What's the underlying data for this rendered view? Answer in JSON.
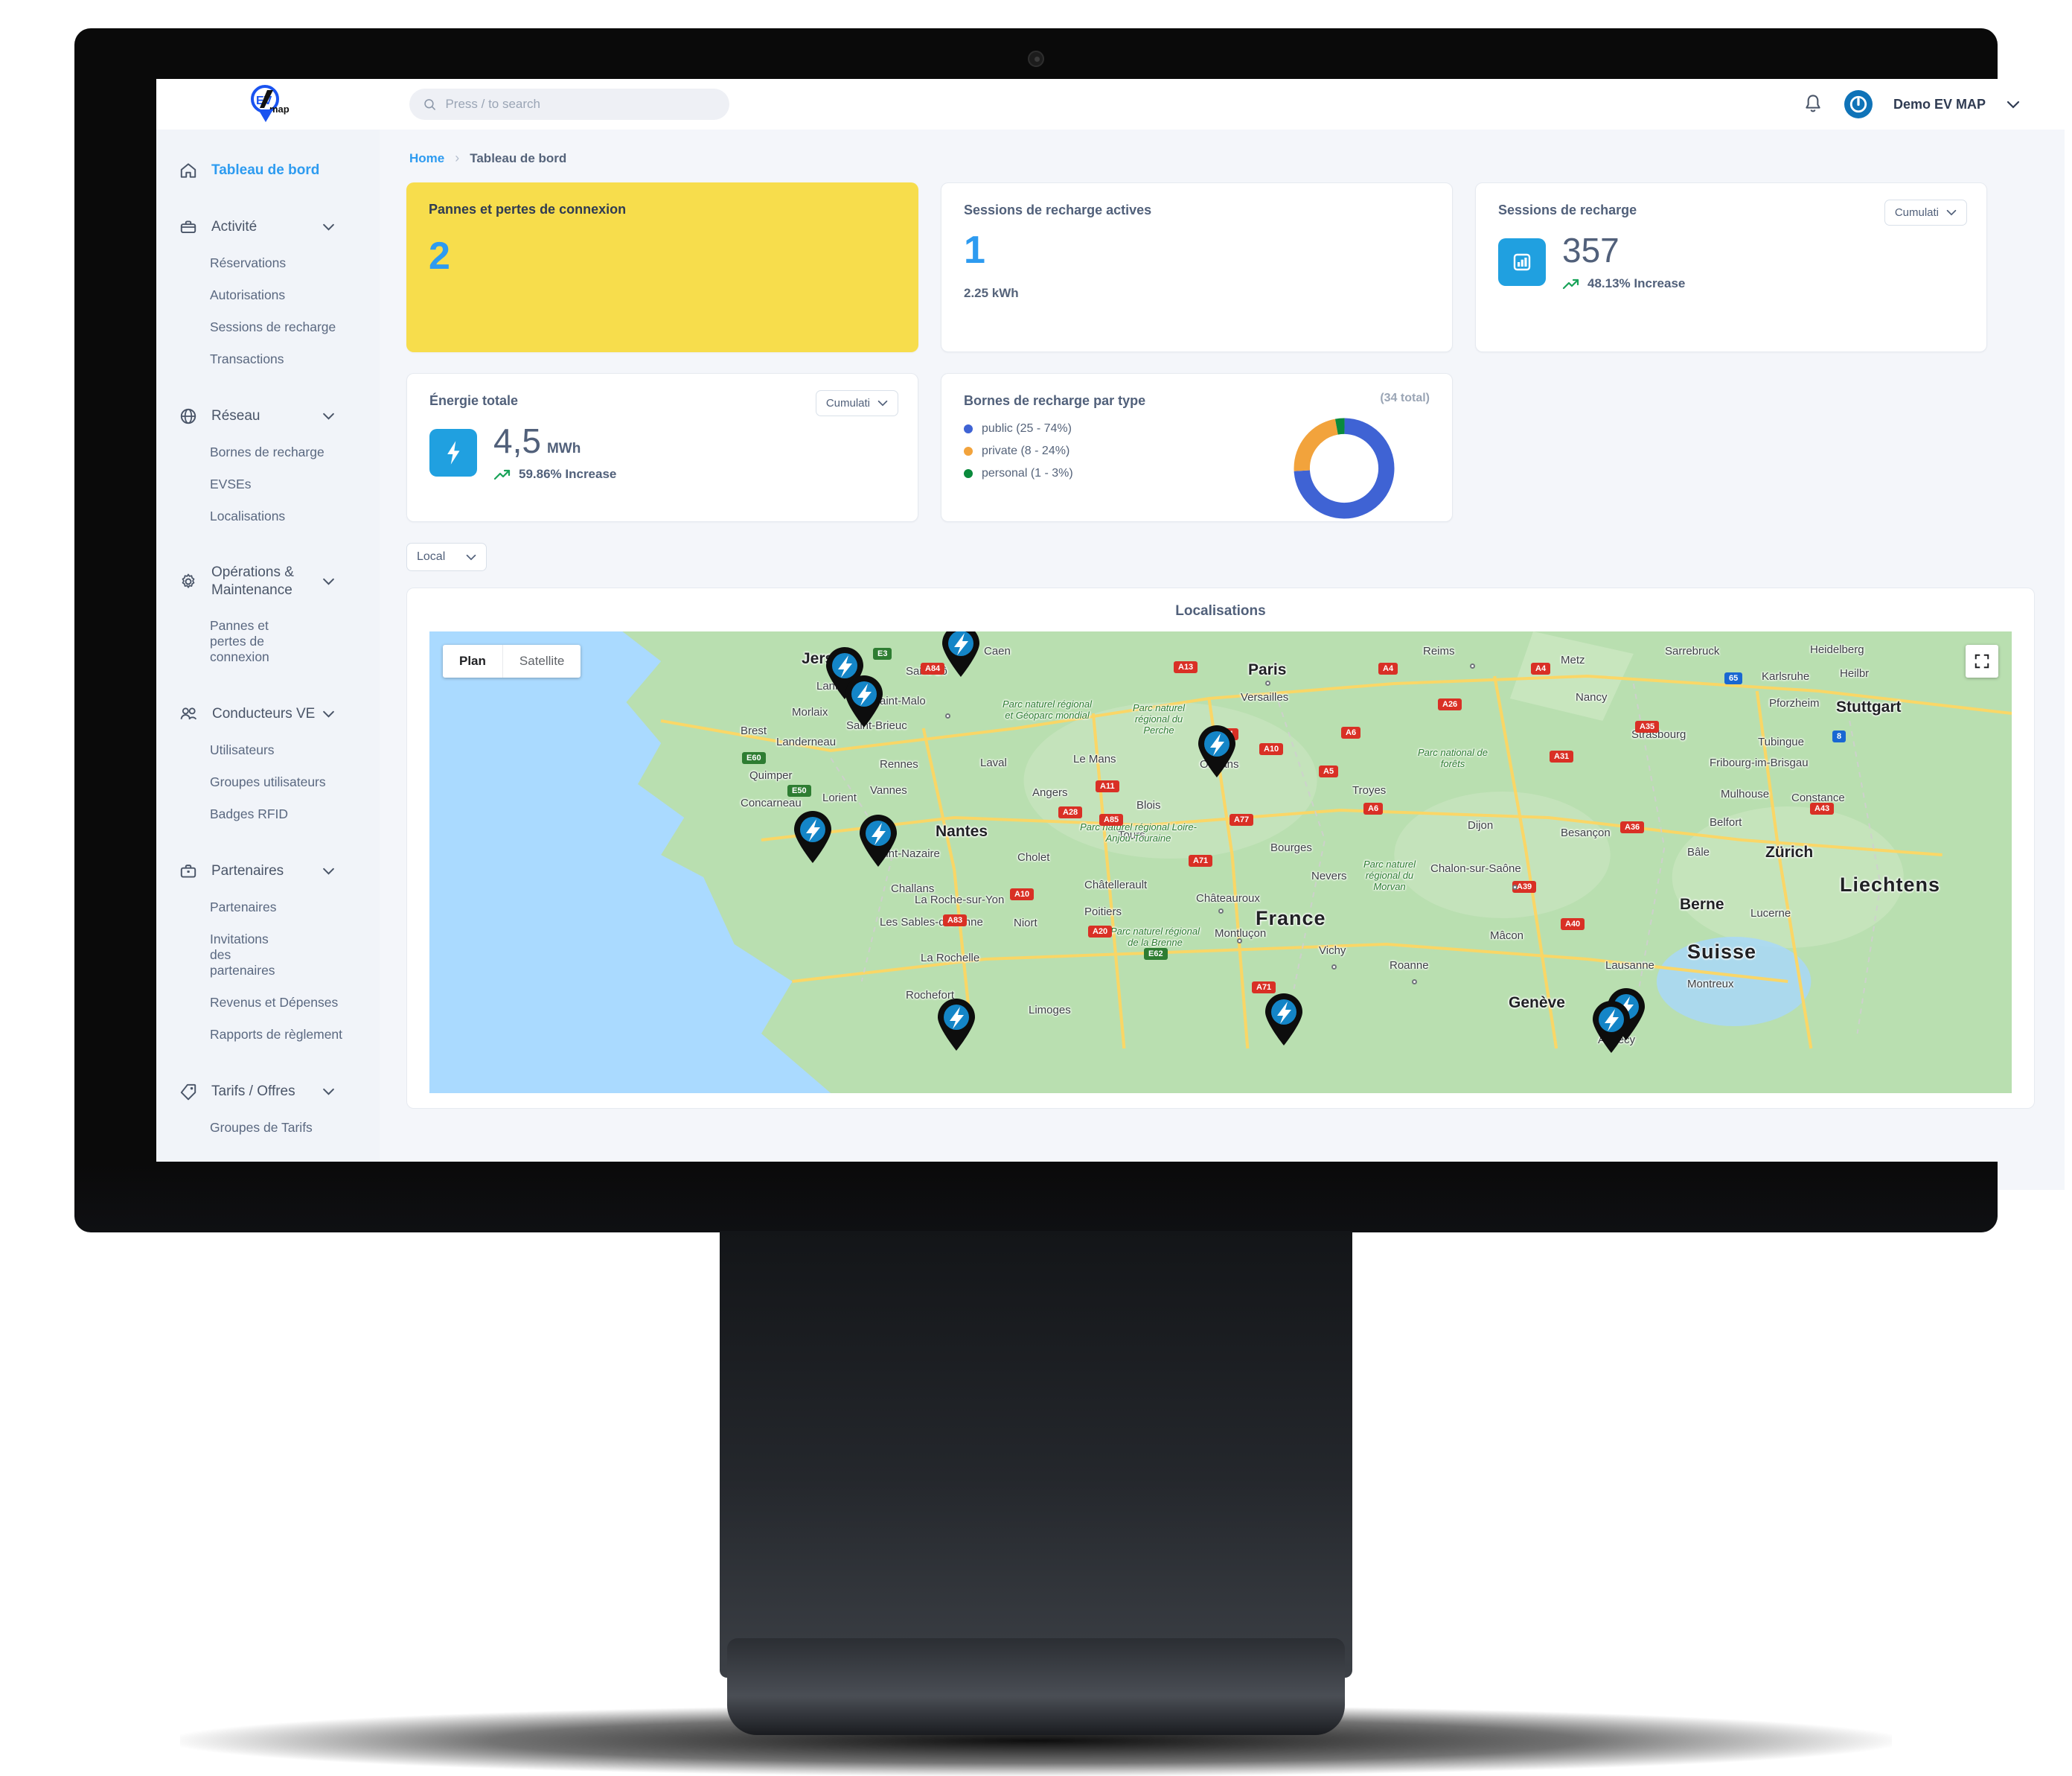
{
  "header": {
    "logo_text_main": "EV",
    "logo_text_sub": "map",
    "search_placeholder": "Press / to search",
    "search_value": "",
    "account_name": "Demo EV MAP"
  },
  "breadcrumb": {
    "home": "Home",
    "separator": "›",
    "current": "Tableau de bord"
  },
  "sidebar": {
    "dashboard": "Tableau de bord",
    "groups": [
      {
        "label": "Activité",
        "icon": "briefcase-icon",
        "items": [
          "Réservations",
          "Autorisations",
          "Sessions de recharge",
          "Transactions"
        ]
      },
      {
        "label": "Réseau",
        "icon": "globe-icon",
        "items": [
          "Bornes de recharge",
          "EVSEs",
          "Localisations"
        ]
      },
      {
        "label": "Opérations & Maintenance",
        "icon": "gear-icon",
        "items": [
          "Pannes et pertes de connexion"
        ]
      },
      {
        "label": "Conducteurs VE",
        "icon": "users-icon",
        "items": [
          "Utilisateurs",
          "Groupes utilisateurs",
          "Badges RFID"
        ]
      },
      {
        "label": "Partenaires",
        "icon": "briefcase-icon",
        "items": [
          "Partenaires",
          "Invitations des partenaires",
          "Revenus et Dépenses",
          "Rapports de règlement"
        ]
      },
      {
        "label": "Tarifs / Offres",
        "icon": "tag-icon",
        "items": [
          "Groupes de Tarifs"
        ]
      }
    ]
  },
  "cards": {
    "alerts": {
      "title": "Pannes et pertes de connexion",
      "value": "2"
    },
    "active_sessions": {
      "title": "Sessions de recharge actives",
      "value": "1",
      "subtitle": "2.25 kWh"
    },
    "sessions": {
      "title": "Sessions de recharge",
      "select": "Cumulati",
      "value": "357",
      "trend": "48.13% Increase",
      "icon": "bar-chart-icon"
    },
    "energy": {
      "title": "Énergie totale",
      "select": "Cumulati",
      "value": "4,5",
      "unit": "MWh",
      "trend": "59.86% Increase",
      "icon": "lightning-icon"
    },
    "types": {
      "title": "Bornes de recharge par type",
      "total": "(34 total)"
    }
  },
  "chart_data": {
    "type": "pie",
    "title": "Bornes de recharge par type",
    "total": 34,
    "total_label": "(34 total)",
    "categories": [
      "public",
      "private",
      "personal"
    ],
    "values": [
      25,
      8,
      1
    ],
    "percentages": [
      74,
      24,
      3
    ],
    "colors": [
      "#3f63d4",
      "#f2a33c",
      "#0a8a3c"
    ],
    "legend": [
      "public (25 - 74%)",
      "private (8 - 24%)",
      "personal (1 - 3%)"
    ],
    "legend_position": "left",
    "donut": true
  },
  "map_section": {
    "scope_select": "Local",
    "card_title": "Localisations",
    "toggle": {
      "plan": "Plan",
      "satellite": "Satellite",
      "selected": "Plan"
    },
    "fullscreen_icon": "fullscreen-icon",
    "marker_count": 10,
    "labels": {
      "countries": [
        "France",
        "Suisse",
        "Liechtens"
      ],
      "cities_big": [
        "Jersey",
        "Paris",
        "Stuttgart",
        "Zürich",
        "Berne",
        "Genève",
        "Nantes",
        "Dijon"
      ],
      "cities": [
        "Lannion",
        "Morlaix",
        "Saint-Brieuc",
        "Saint-Malo",
        "Caen",
        "Saint-Lô",
        "Brest",
        "Landerneau",
        "Rennes",
        "Laval",
        "Le Mans",
        "Orléans",
        "Quimper",
        "Concarneau",
        "Lorient",
        "Vannes",
        "Angers",
        "Tours",
        "Saint-Nazaire",
        "Cholet",
        "Blois",
        "Bourges",
        "Nevers",
        "Troyes",
        "Challans",
        "Châtellerault",
        "Poitiers",
        "Châteauroux",
        "Montluçon",
        "Vichy",
        "Les Sables-d'Olonne",
        "La Roche-sur-Yon",
        "Niort",
        "La Rochelle",
        "Rochefort",
        "Chalon-sur-Saône",
        "Mâcon",
        "Roanne",
        "Besançon",
        "Belfort",
        "Mulhouse",
        "Strasbourg",
        "Metz",
        "Nancy",
        "Reims",
        "Versailles",
        "Sarrebruck",
        "Karlsruhe",
        "Heidelberg",
        "Heilbr",
        "Pforzheim",
        "Tubingue",
        "Fribourg-im-Brisgau",
        "Constance",
        "Bâle",
        "Lausanne",
        "Montreux",
        "Annecy",
        "Limoges"
      ],
      "parks": [
        "Parc naturel régional et Géoparc mondial",
        "Parc naturel régional du Perche",
        "Parc national de forêts",
        "Parc naturel régional Loire-Anjou-Touraine",
        "Parc naturel régional de la Brenne",
        "Parc naturel régional du Morvan"
      ],
      "roads": [
        "A84",
        "E3",
        "E50",
        "E60",
        "A13",
        "A4",
        "A26",
        "A31",
        "A11",
        "A10",
        "A6",
        "A77",
        "A71",
        "A28",
        "A85",
        "A83",
        "A10",
        "A20",
        "E62",
        "A36",
        "A35",
        "A5",
        "A40",
        "A39",
        "A6",
        "A43",
        "8"
      ]
    }
  }
}
